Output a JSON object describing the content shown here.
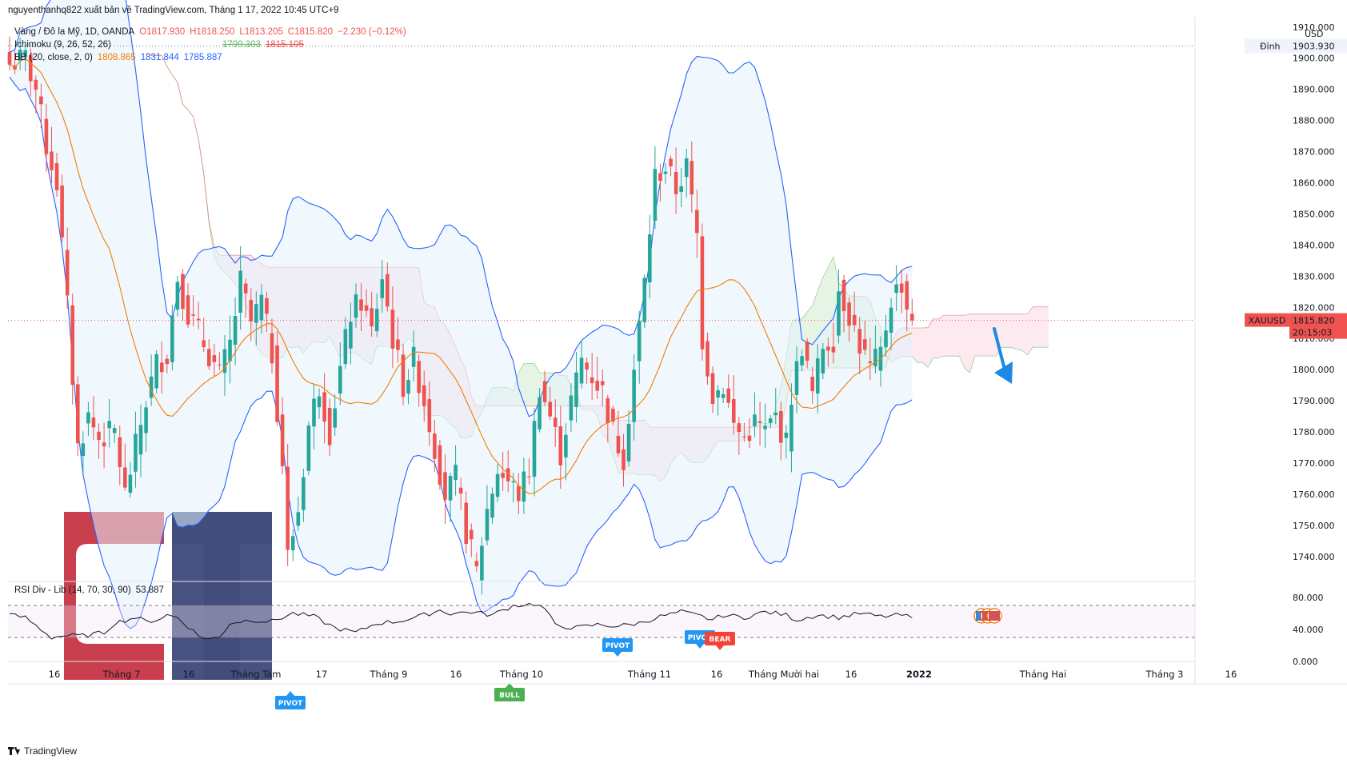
{
  "header": {
    "publisher": "nguyenthanhq822 xuất bản về TradingView.com, Tháng 1 17, 2022 10:45 UTC+9",
    "symbol_line": "Vàng / Đô la Mỹ, 1D, OANDA",
    "open": "O1817.930",
    "high": "H1818.250",
    "low": "L1813.205",
    "close": "C1815.820",
    "change": "−2.230 (−0.12%)",
    "ichimoku_label": "Ichimoku (9, 26, 52, 26)",
    "ichimoku_v1": "1799.303",
    "ichimoku_v2": "1815.105",
    "bb_label": "BB (20, close, 2, 0)",
    "bb_basis": "1808.865",
    "bb_upper": "1831.844",
    "bb_lower": "1785.887"
  },
  "rsi_legend": {
    "label": "RSI Div - Lib (14, 70, 30, 90)",
    "value": "53.887"
  },
  "price_axis": {
    "currency": "USD",
    "top_label": "1910.000",
    "ticks": [
      "1900.000",
      "1890.000",
      "1880.000",
      "1870.000",
      "1860.000",
      "1850.000",
      "1840.000",
      "1830.000",
      "1820.000",
      "1810.000",
      "1800.000",
      "1790.000",
      "1780.000",
      "1770.000",
      "1760.000",
      "1750.000",
      "1740.000"
    ],
    "high_label": "Đỉnh",
    "high_value": "1903.930",
    "symbol_tag": "XAUUSD",
    "last_price": "1815.820",
    "countdown": "20:15:03"
  },
  "rsi_axis": {
    "ticks": [
      "80.000",
      "40.000",
      "0.000"
    ]
  },
  "x_axis": {
    "labels": [
      "16",
      "Tháng 7",
      "16",
      "Tháng Tám",
      "17",
      "Tháng 9",
      "16",
      "Tháng 10",
      "Tháng 11",
      "16",
      "Tháng Mười hai",
      "16",
      "2022",
      "Tháng Hai",
      "Tháng 3",
      "16"
    ]
  },
  "signals": {
    "pivot": "PIVOT",
    "bull": "BULL",
    "bear": "BEAR"
  },
  "watermark": {
    "letters": "GT"
  },
  "footer": {
    "brand": "TradingView"
  },
  "colors": {
    "up": "#26a69a",
    "down": "#ef5350",
    "bb_basis": "#f57c00",
    "bb_band": "#2962ff",
    "cloud_bull": "#a5d6a7",
    "cloud_bear": "#f8bbd0",
    "pivot": "#2196f3",
    "bull": "#4caf50",
    "bear": "#f44336",
    "watermark_red": "#c62f3e",
    "watermark_navy": "#2e3a6e"
  },
  "chart_data": {
    "type": "candlestick",
    "title": "Vàng / Đô la Mỹ, 1D, OANDA",
    "symbol": "XAUUSD",
    "ylim": [
      1732,
      1912
    ],
    "last_price": 1815.82,
    "anchors": [
      [
        0,
        1898
      ],
      [
        3,
        1900
      ],
      [
        5,
        1890
      ],
      [
        7,
        1872
      ],
      [
        9,
        1860
      ],
      [
        11,
        1820
      ],
      [
        13,
        1775
      ],
      [
        15,
        1785
      ],
      [
        17,
        1778
      ],
      [
        20,
        1780
      ],
      [
        22,
        1760
      ],
      [
        24,
        1775
      ],
      [
        26,
        1790
      ],
      [
        28,
        1802
      ],
      [
        30,
        1805
      ],
      [
        32,
        1830
      ],
      [
        34,
        1818
      ],
      [
        36,
        1812
      ],
      [
        38,
        1805
      ],
      [
        40,
        1798
      ],
      [
        42,
        1808
      ],
      [
        44,
        1828
      ],
      [
        46,
        1815
      ],
      [
        48,
        1822
      ],
      [
        50,
        1805
      ],
      [
        52,
        1770
      ],
      [
        53,
        1740
      ],
      [
        55,
        1755
      ],
      [
        57,
        1782
      ],
      [
        59,
        1795
      ],
      [
        61,
        1780
      ],
      [
        63,
        1800
      ],
      [
        65,
        1818
      ],
      [
        67,
        1822
      ],
      [
        69,
        1812
      ],
      [
        71,
        1830
      ],
      [
        73,
        1810
      ],
      [
        75,
        1795
      ],
      [
        77,
        1803
      ],
      [
        79,
        1790
      ],
      [
        81,
        1775
      ],
      [
        83,
        1760
      ],
      [
        85,
        1765
      ],
      [
        87,
        1748
      ],
      [
        89,
        1735
      ],
      [
        91,
        1755
      ],
      [
        93,
        1768
      ],
      [
        95,
        1764
      ],
      [
        97,
        1760
      ],
      [
        99,
        1768
      ],
      [
        101,
        1795
      ],
      [
        103,
        1785
      ],
      [
        105,
        1773
      ],
      [
        107,
        1790
      ],
      [
        109,
        1803
      ],
      [
        111,
        1798
      ],
      [
        113,
        1793
      ],
      [
        115,
        1780
      ],
      [
        117,
        1772
      ],
      [
        119,
        1800
      ],
      [
        121,
        1828
      ],
      [
        123,
        1862
      ],
      [
        125,
        1865
      ],
      [
        127,
        1858
      ],
      [
        129,
        1865
      ],
      [
        131,
        1843
      ],
      [
        132,
        1810
      ],
      [
        134,
        1792
      ],
      [
        136,
        1795
      ],
      [
        138,
        1782
      ],
      [
        140,
        1778
      ],
      [
        142,
        1783
      ],
      [
        144,
        1780
      ],
      [
        146,
        1785
      ],
      [
        148,
        1776
      ],
      [
        149,
        1792
      ],
      [
        151,
        1808
      ],
      [
        153,
        1792
      ],
      [
        155,
        1808
      ],
      [
        157,
        1810
      ],
      [
        158,
        1826
      ],
      [
        160,
        1818
      ],
      [
        162,
        1808
      ],
      [
        164,
        1800
      ],
      [
        166,
        1805
      ],
      [
        168,
        1823
      ],
      [
        170,
        1828
      ],
      [
        171,
        1820
      ],
      [
        172,
        1816
      ]
    ],
    "rsi": {
      "ylim": [
        0,
        100
      ],
      "overbought": 70,
      "oversold": 30,
      "anchors": [
        [
          0,
          58
        ],
        [
          3,
          55
        ],
        [
          6,
          40
        ],
        [
          8,
          30
        ],
        [
          10,
          32
        ],
        [
          14,
          32
        ],
        [
          18,
          36
        ],
        [
          20,
          48
        ],
        [
          24,
          55
        ],
        [
          26,
          50
        ],
        [
          28,
          52
        ],
        [
          30,
          58
        ],
        [
          32,
          55
        ],
        [
          34,
          44
        ],
        [
          36,
          32
        ],
        [
          38,
          28
        ],
        [
          40,
          30
        ],
        [
          42,
          48
        ],
        [
          46,
          52
        ],
        [
          50,
          50
        ],
        [
          54,
          60
        ],
        [
          58,
          56
        ],
        [
          62,
          42
        ],
        [
          66,
          36
        ],
        [
          70,
          48
        ],
        [
          74,
          50
        ],
        [
          78,
          56
        ],
        [
          82,
          64
        ],
        [
          84,
          60
        ],
        [
          88,
          62
        ],
        [
          92,
          58
        ],
        [
          96,
          70
        ],
        [
          100,
          72
        ],
        [
          102,
          66
        ],
        [
          104,
          45
        ],
        [
          108,
          42
        ],
        [
          112,
          46
        ],
        [
          116,
          44
        ],
        [
          120,
          48
        ],
        [
          124,
          56
        ],
        [
          128,
          62
        ],
        [
          132,
          56
        ],
        [
          134,
          52
        ],
        [
          136,
          58
        ],
        [
          140,
          55
        ],
        [
          144,
          62
        ],
        [
          148,
          58
        ],
        [
          150,
          52
        ],
        [
          154,
          58
        ],
        [
          158,
          55
        ],
        [
          162,
          60
        ],
        [
          166,
          56
        ],
        [
          170,
          58
        ],
        [
          172,
          54
        ]
      ]
    }
  }
}
